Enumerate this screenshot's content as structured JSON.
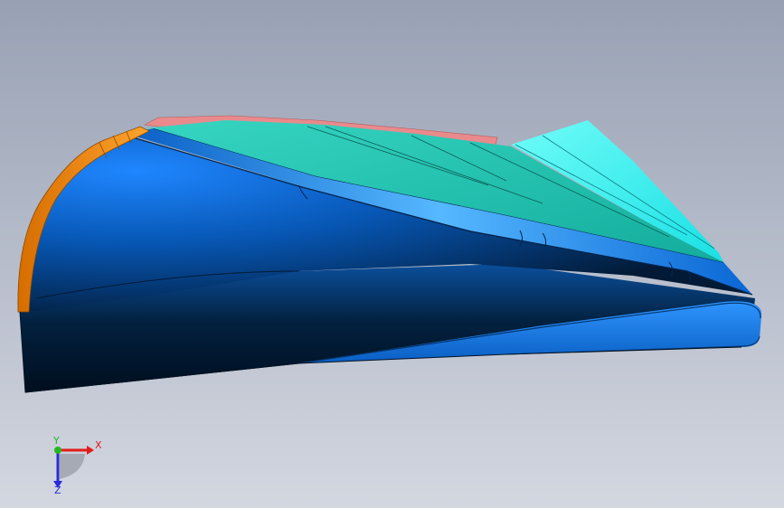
{
  "viewport": {
    "background_top": "#9aa3b5",
    "background_bottom": "#d2d6df"
  },
  "model": {
    "colors": {
      "dark_shell": "#001a38",
      "blue_face": "#0a6fd8",
      "bright_blue": "#2b8fff",
      "teal_face": "#22c4b2",
      "cyan_face": "#3ff5f2",
      "orange_edge": "#f08a12",
      "pink_edge": "#e88a8a"
    }
  },
  "triad": {
    "x_label": "X",
    "y_label": "Y",
    "z_label": "Z",
    "x_color": "#e31b1b",
    "y_color": "#22b822",
    "z_color": "#2a2ad9"
  }
}
